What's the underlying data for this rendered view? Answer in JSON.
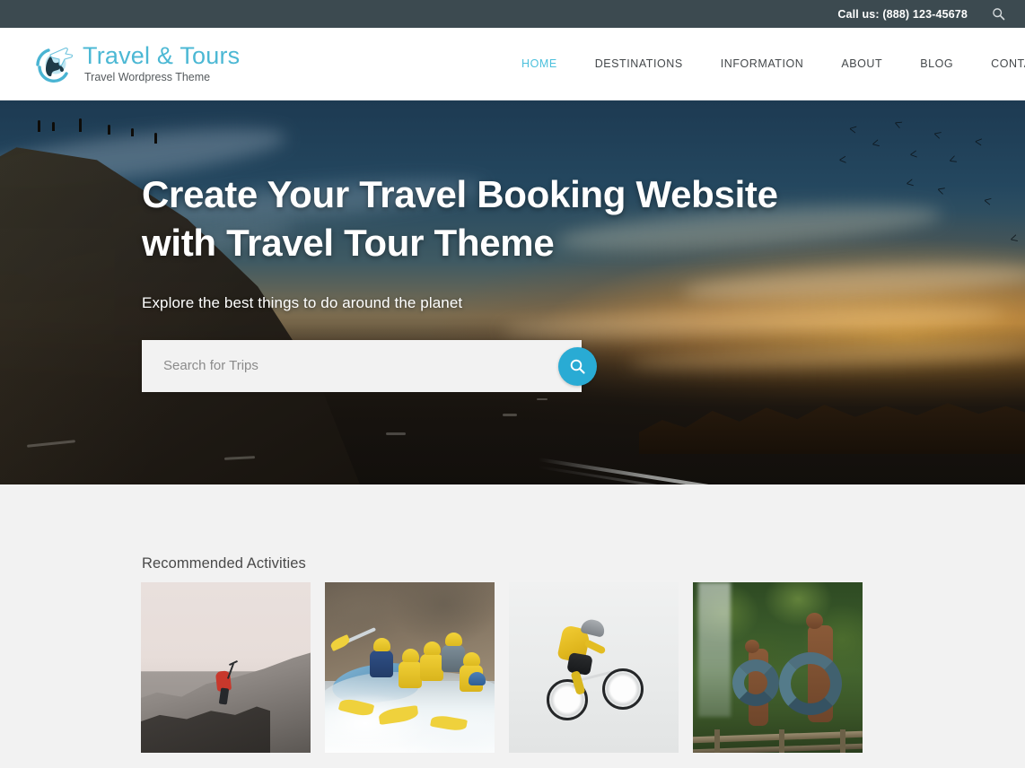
{
  "topbar": {
    "phone_label": "Call us: (888) 123-45678",
    "search_icon": "search-icon"
  },
  "header": {
    "logo": {
      "title": "Travel & Tours",
      "tagline": "Travel Wordpress Theme",
      "icon": "globe-airplane-logo-icon"
    },
    "nav": [
      {
        "label": "HOME",
        "active": true
      },
      {
        "label": "DESTINATIONS",
        "active": false
      },
      {
        "label": "INFORMATION",
        "active": false
      },
      {
        "label": "ABOUT",
        "active": false
      },
      {
        "label": "BLOG",
        "active": false
      },
      {
        "label": "CONTACT",
        "active": false
      }
    ]
  },
  "hero": {
    "title_line1": "Create Your Travel Booking Website",
    "title_line2": "with Travel Tour Theme",
    "subtitle": "Explore the best things to do around the planet",
    "search": {
      "placeholder": "Search for Trips",
      "value": "",
      "button_icon": "search-icon"
    }
  },
  "activities": {
    "heading": "Recommended Activities",
    "cards": [
      {
        "name": "rock-climbing"
      },
      {
        "name": "white-water-rafting"
      },
      {
        "name": "mountain-biking"
      },
      {
        "name": "river-tubing"
      }
    ]
  },
  "colors": {
    "topbar_bg": "#3c4a50",
    "accent_cyan": "#29abd4",
    "logo_cyan": "#4cb8d4",
    "nav_active": "#4cc0dc",
    "section_bg": "#f2f2f2",
    "text_dark": "#44484b"
  }
}
